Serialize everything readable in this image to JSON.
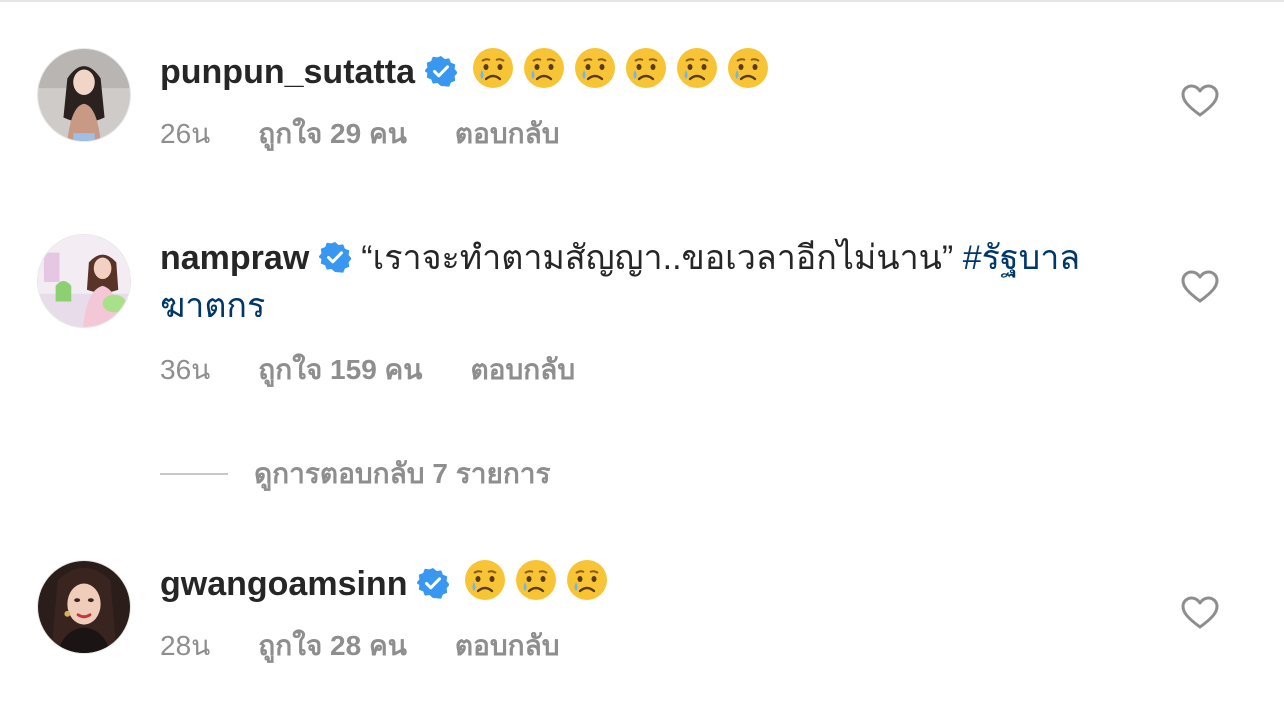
{
  "comments": [
    {
      "username": "punpun_sutatta",
      "verified": true,
      "text": "",
      "emoji": [
        "crying-face",
        "crying-face",
        "crying-face",
        "crying-face",
        "crying-face",
        "crying-face"
      ],
      "time": "26น",
      "likes": "ถูกใจ 29 คน",
      "reply": "ตอบกลับ"
    },
    {
      "username": "nampraw",
      "verified": true,
      "text": "“เราจะทำตามสัญญา..ขอเวลาอีกไม่นาน”",
      "hashtag": "#รัฐบาล",
      "hashtag_cont": "ฆาตกร",
      "time": "36น",
      "likes": "ถูกใจ 159 คน",
      "reply": "ตอบกลับ",
      "view_replies": "ดูการตอบกลับ 7 รายการ"
    },
    {
      "username": "gwangoamsinn",
      "verified": true,
      "text": "",
      "emoji": [
        "crying-face",
        "crying-face",
        "crying-face"
      ],
      "time": "28น",
      "likes": "ถูกใจ 28 คน",
      "reply": "ตอบกลับ"
    }
  ],
  "icons": {
    "verified_badge": "verified-badge-icon",
    "like": "heart-outline-icon"
  },
  "colors": {
    "text": "#262626",
    "secondary": "#8e8e8e",
    "verified": "#3897f0",
    "hashtag": "#00376b"
  }
}
